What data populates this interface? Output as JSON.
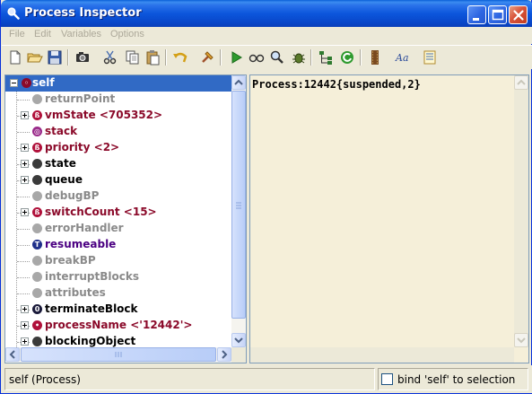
{
  "window": {
    "title": "Process Inspector",
    "controls": [
      "minimize",
      "maximize",
      "close"
    ]
  },
  "menu": {
    "items": [
      "File",
      "Edit",
      "Variables",
      "Options"
    ]
  },
  "toolbar": {
    "icons": [
      "new-document-icon",
      "open-folder-icon",
      "save-icon",
      "camera-icon",
      "scissors-icon",
      "copy-icon",
      "paste-icon",
      "undo-icon",
      "hammer-icon",
      "run-icon",
      "glasses-icon",
      "magnifier-icon",
      "bug-icon",
      "hierarchy-icon",
      "refresh-icon",
      "film-icon",
      "font-icon",
      "notes-icon"
    ]
  },
  "tree": {
    "root": {
      "label": "self"
    },
    "items": [
      {
        "label": "returnPoint",
        "expandable": false,
        "icon": "gray",
        "color": "#8a8a8a"
      },
      {
        "label": "vmState <705352>",
        "expandable": true,
        "icon": "integer",
        "color": "#8b0a2a"
      },
      {
        "label": "stack",
        "expandable": false,
        "icon": "stack",
        "color": "#8b0a2a"
      },
      {
        "label": "priority <2>",
        "expandable": true,
        "icon": "integer",
        "color": "#8b0a2a"
      },
      {
        "label": "state",
        "expandable": true,
        "icon": "dark",
        "color": "#000000"
      },
      {
        "label": "queue",
        "expandable": true,
        "icon": "dark",
        "color": "#000000"
      },
      {
        "label": "debugBP",
        "expandable": false,
        "icon": "gray",
        "color": "#8a8a8a"
      },
      {
        "label": "switchCount <15>",
        "expandable": true,
        "icon": "integer",
        "color": "#8b0a2a"
      },
      {
        "label": "errorHandler",
        "expandable": false,
        "icon": "gray",
        "color": "#8a8a8a"
      },
      {
        "label": "resumeable",
        "expandable": false,
        "icon": "true",
        "color": "#4b0082"
      },
      {
        "label": "breakBP",
        "expandable": false,
        "icon": "gray",
        "color": "#8a8a8a"
      },
      {
        "label": "interruptBlocks",
        "expandable": false,
        "icon": "gray",
        "color": "#8a8a8a"
      },
      {
        "label": "attributes",
        "expandable": false,
        "icon": "gray",
        "color": "#8a8a8a"
      },
      {
        "label": "terminateBlock",
        "expandable": true,
        "icon": "block",
        "color": "#000000"
      },
      {
        "label": "processName <'12442'>",
        "expandable": true,
        "icon": "string",
        "color": "#8b0a2a"
      },
      {
        "label": "blockingObject",
        "expandable": true,
        "icon": "dark",
        "color": "#000000"
      }
    ]
  },
  "value_pane": {
    "text": "Process:12442{suspended,2}"
  },
  "status": {
    "left_text": "self (Process)",
    "checkbox_label": "bind 'self' to selection",
    "checkbox_checked": false
  }
}
